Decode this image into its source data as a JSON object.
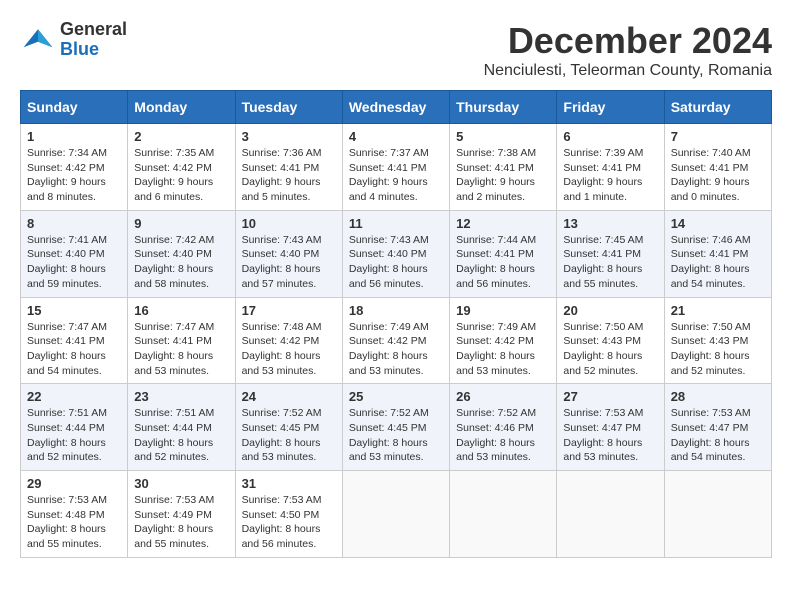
{
  "header": {
    "logo_line1": "General",
    "logo_line2": "Blue",
    "month_year": "December 2024",
    "location": "Nenciulesti, Teleorman County, Romania"
  },
  "days_of_week": [
    "Sunday",
    "Monday",
    "Tuesday",
    "Wednesday",
    "Thursday",
    "Friday",
    "Saturday"
  ],
  "weeks": [
    [
      {
        "day": "1",
        "sunrise": "7:34 AM",
        "sunset": "4:42 PM",
        "daylight": "9 hours and 8 minutes."
      },
      {
        "day": "2",
        "sunrise": "7:35 AM",
        "sunset": "4:42 PM",
        "daylight": "9 hours and 6 minutes."
      },
      {
        "day": "3",
        "sunrise": "7:36 AM",
        "sunset": "4:41 PM",
        "daylight": "9 hours and 5 minutes."
      },
      {
        "day": "4",
        "sunrise": "7:37 AM",
        "sunset": "4:41 PM",
        "daylight": "9 hours and 4 minutes."
      },
      {
        "day": "5",
        "sunrise": "7:38 AM",
        "sunset": "4:41 PM",
        "daylight": "9 hours and 2 minutes."
      },
      {
        "day": "6",
        "sunrise": "7:39 AM",
        "sunset": "4:41 PM",
        "daylight": "9 hours and 1 minute."
      },
      {
        "day": "7",
        "sunrise": "7:40 AM",
        "sunset": "4:41 PM",
        "daylight": "9 hours and 0 minutes."
      }
    ],
    [
      {
        "day": "8",
        "sunrise": "7:41 AM",
        "sunset": "4:40 PM",
        "daylight": "8 hours and 59 minutes."
      },
      {
        "day": "9",
        "sunrise": "7:42 AM",
        "sunset": "4:40 PM",
        "daylight": "8 hours and 58 minutes."
      },
      {
        "day": "10",
        "sunrise": "7:43 AM",
        "sunset": "4:40 PM",
        "daylight": "8 hours and 57 minutes."
      },
      {
        "day": "11",
        "sunrise": "7:43 AM",
        "sunset": "4:40 PM",
        "daylight": "8 hours and 56 minutes."
      },
      {
        "day": "12",
        "sunrise": "7:44 AM",
        "sunset": "4:41 PM",
        "daylight": "8 hours and 56 minutes."
      },
      {
        "day": "13",
        "sunrise": "7:45 AM",
        "sunset": "4:41 PM",
        "daylight": "8 hours and 55 minutes."
      },
      {
        "day": "14",
        "sunrise": "7:46 AM",
        "sunset": "4:41 PM",
        "daylight": "8 hours and 54 minutes."
      }
    ],
    [
      {
        "day": "15",
        "sunrise": "7:47 AM",
        "sunset": "4:41 PM",
        "daylight": "8 hours and 54 minutes."
      },
      {
        "day": "16",
        "sunrise": "7:47 AM",
        "sunset": "4:41 PM",
        "daylight": "8 hours and 53 minutes."
      },
      {
        "day": "17",
        "sunrise": "7:48 AM",
        "sunset": "4:42 PM",
        "daylight": "8 hours and 53 minutes."
      },
      {
        "day": "18",
        "sunrise": "7:49 AM",
        "sunset": "4:42 PM",
        "daylight": "8 hours and 53 minutes."
      },
      {
        "day": "19",
        "sunrise": "7:49 AM",
        "sunset": "4:42 PM",
        "daylight": "8 hours and 53 minutes."
      },
      {
        "day": "20",
        "sunrise": "7:50 AM",
        "sunset": "4:43 PM",
        "daylight": "8 hours and 52 minutes."
      },
      {
        "day": "21",
        "sunrise": "7:50 AM",
        "sunset": "4:43 PM",
        "daylight": "8 hours and 52 minutes."
      }
    ],
    [
      {
        "day": "22",
        "sunrise": "7:51 AM",
        "sunset": "4:44 PM",
        "daylight": "8 hours and 52 minutes."
      },
      {
        "day": "23",
        "sunrise": "7:51 AM",
        "sunset": "4:44 PM",
        "daylight": "8 hours and 52 minutes."
      },
      {
        "day": "24",
        "sunrise": "7:52 AM",
        "sunset": "4:45 PM",
        "daylight": "8 hours and 53 minutes."
      },
      {
        "day": "25",
        "sunrise": "7:52 AM",
        "sunset": "4:45 PM",
        "daylight": "8 hours and 53 minutes."
      },
      {
        "day": "26",
        "sunrise": "7:52 AM",
        "sunset": "4:46 PM",
        "daylight": "8 hours and 53 minutes."
      },
      {
        "day": "27",
        "sunrise": "7:53 AM",
        "sunset": "4:47 PM",
        "daylight": "8 hours and 53 minutes."
      },
      {
        "day": "28",
        "sunrise": "7:53 AM",
        "sunset": "4:47 PM",
        "daylight": "8 hours and 54 minutes."
      }
    ],
    [
      {
        "day": "29",
        "sunrise": "7:53 AM",
        "sunset": "4:48 PM",
        "daylight": "8 hours and 55 minutes."
      },
      {
        "day": "30",
        "sunrise": "7:53 AM",
        "sunset": "4:49 PM",
        "daylight": "8 hours and 55 minutes."
      },
      {
        "day": "31",
        "sunrise": "7:53 AM",
        "sunset": "4:50 PM",
        "daylight": "8 hours and 56 minutes."
      },
      null,
      null,
      null,
      null
    ]
  ]
}
